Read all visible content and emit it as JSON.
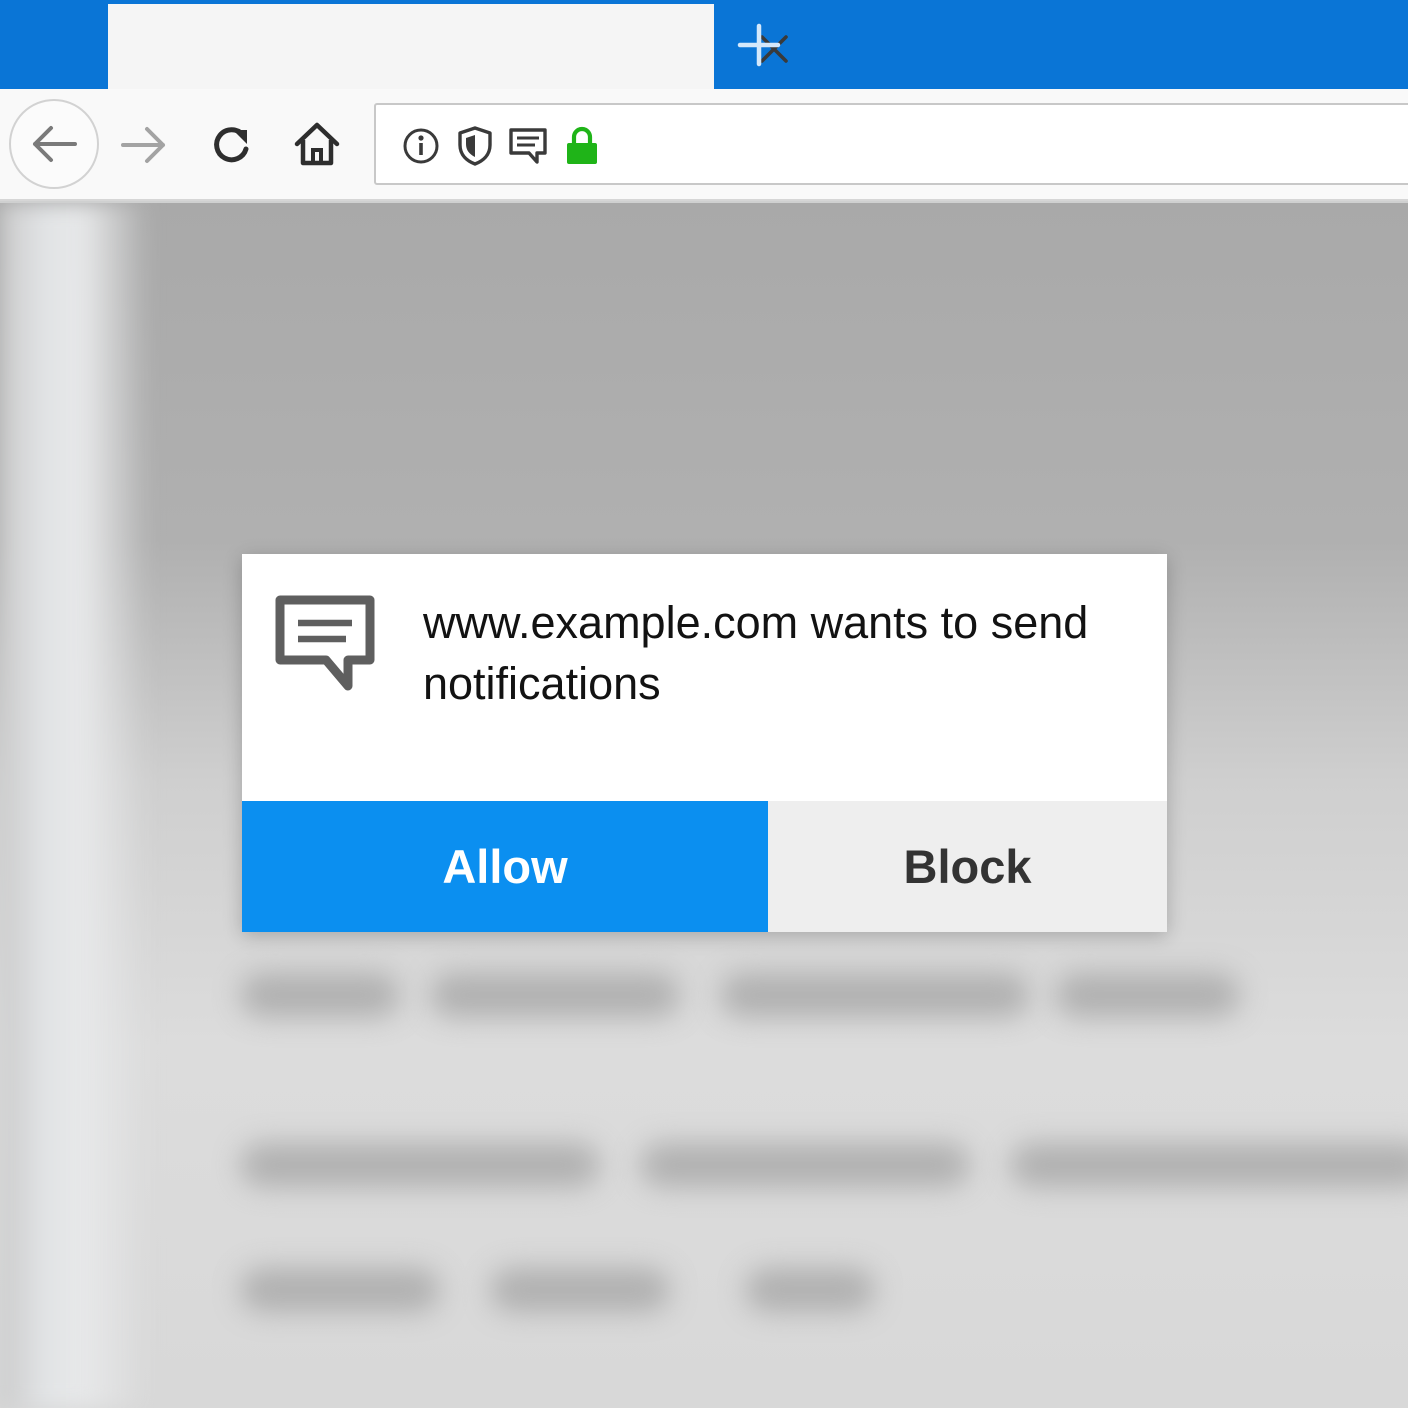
{
  "browser": {
    "tab": {
      "title": "",
      "close_icon": "close-icon"
    },
    "new_tab_icon": "plus-icon",
    "nav": {
      "back_icon": "arrow-left-icon",
      "forward_icon": "arrow-right-icon",
      "reload_icon": "reload-icon",
      "home_icon": "home-icon"
    },
    "url_bar": {
      "icons": [
        "info-icon",
        "shield-icon",
        "notification-icon",
        "lock-icon"
      ],
      "value": ""
    },
    "colors": {
      "tabstrip": "#0a75d6",
      "lock": "#1fb418"
    }
  },
  "dialog": {
    "icon": "message-icon",
    "message": "www.example.com wants to send notifications",
    "allow_label": "Allow",
    "block_label": "Block",
    "colors": {
      "allow_bg": "#0b8ff0",
      "block_bg": "#eeeeee"
    }
  }
}
